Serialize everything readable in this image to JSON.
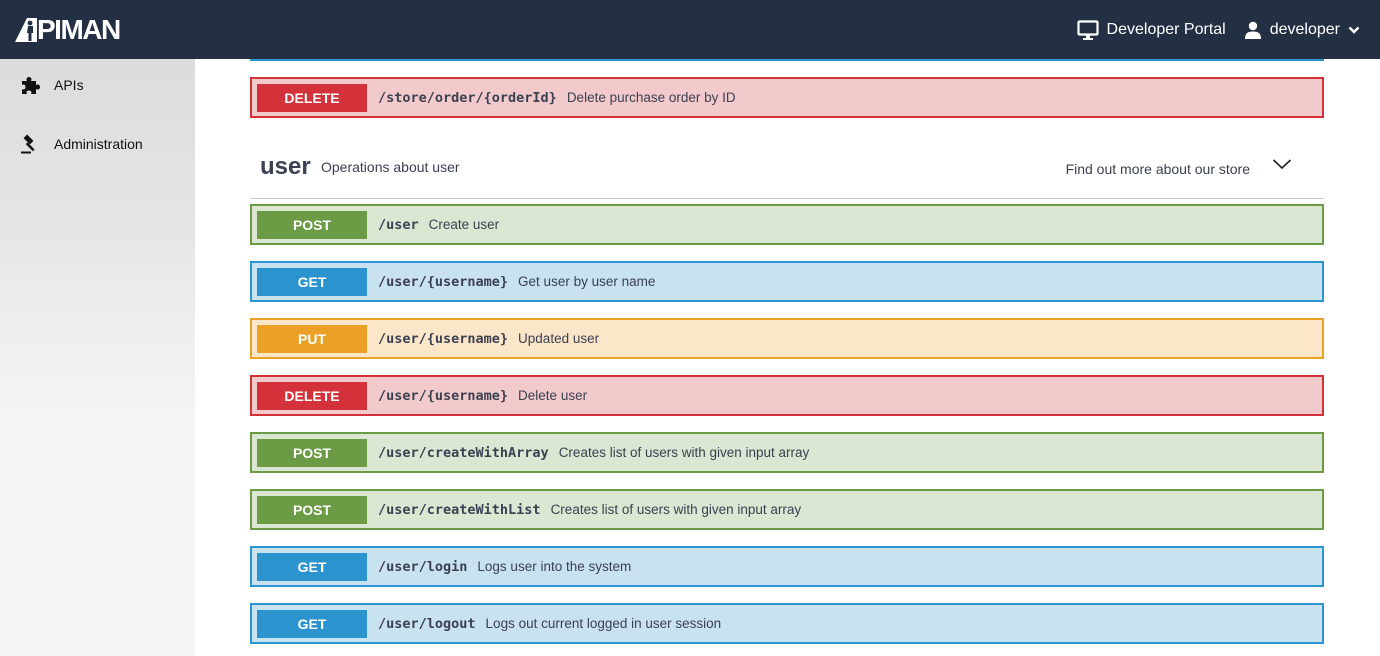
{
  "navbar": {
    "logo_text": "APIMAN",
    "developer_portal_label": "Developer Portal",
    "user_label": "developer",
    "background": "#233044"
  },
  "sidebar": {
    "items": [
      {
        "label": "APIs",
        "icon": "puzzle-piece-icon"
      },
      {
        "label": "Administration",
        "icon": "gavel-icon"
      }
    ]
  },
  "previous_operation": {
    "method": "DELETE",
    "path": "/store/order/{orderId}",
    "description": "Delete purchase order by ID"
  },
  "tag": {
    "name": "user",
    "description": "Operations about user",
    "external_link": "Find out more about our store"
  },
  "operations": [
    {
      "method": "POST",
      "path": "/user",
      "description": "Create user"
    },
    {
      "method": "GET",
      "path": "/user/{username}",
      "description": "Get user by user name"
    },
    {
      "method": "PUT",
      "path": "/user/{username}",
      "description": "Updated user"
    },
    {
      "method": "DELETE",
      "path": "/user/{username}",
      "description": "Delete user"
    },
    {
      "method": "POST",
      "path": "/user/createWithArray",
      "description": "Creates list of users with given input array"
    },
    {
      "method": "POST",
      "path": "/user/createWithList",
      "description": "Creates list of users with given input array"
    },
    {
      "method": "GET",
      "path": "/user/login",
      "description": "Logs user into the system"
    },
    {
      "method": "GET",
      "path": "/user/logout",
      "description": "Logs out current logged in user session"
    }
  ],
  "method_colors": {
    "POST": "#6b9b44",
    "GET": "#2b94cf",
    "PUT": "#eaa126",
    "DELETE": "#d3323a"
  }
}
